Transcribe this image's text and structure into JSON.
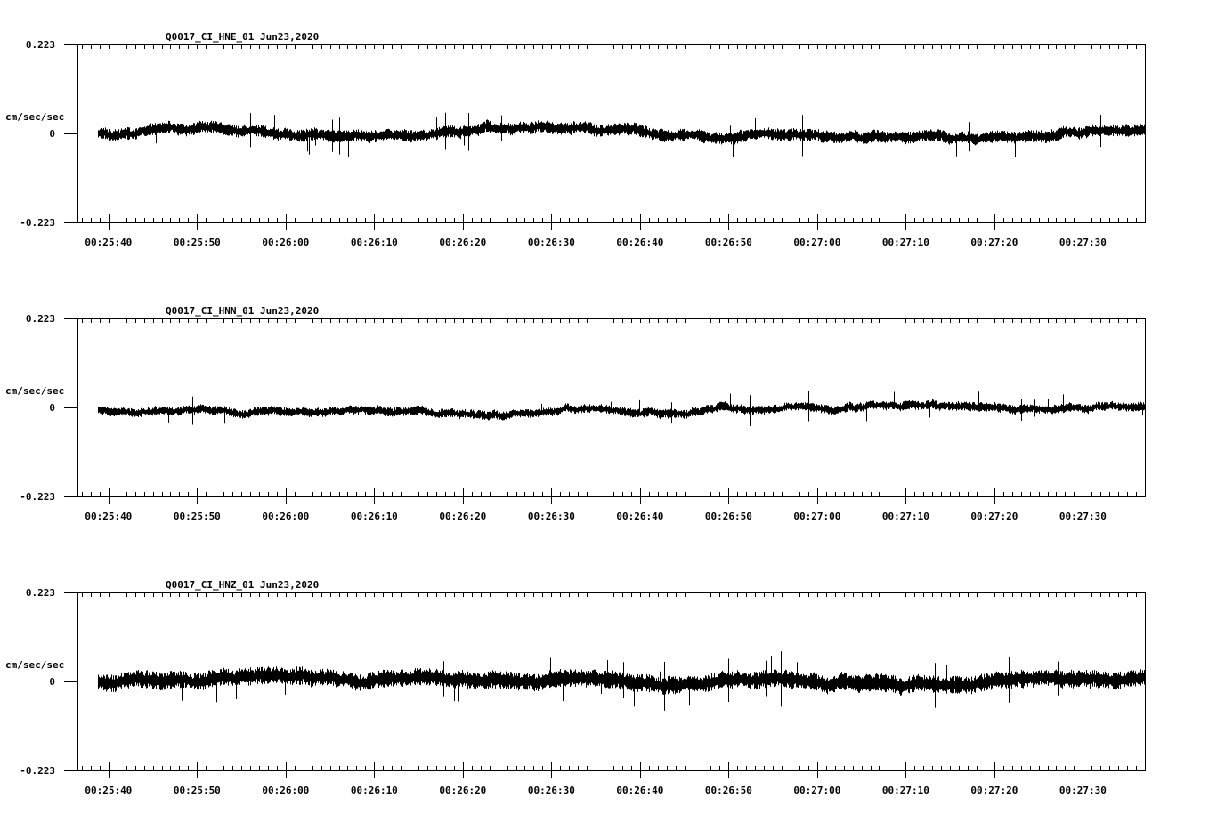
{
  "chart_data": [
    {
      "type": "line",
      "title": "Q0017_CI_HNE_01  Jun23,2020",
      "ylabel": "cm/sec/sec",
      "ylim": [
        -0.223,
        0.223
      ],
      "ytick_labels": [
        "0.223",
        "0",
        "-0.223"
      ],
      "xtick_labels": [
        "00:25:40",
        "00:25:50",
        "00:26:00",
        "00:26:10",
        "00:26:20",
        "00:26:30",
        "00:26:40",
        "00:26:50",
        "00:27:00",
        "00:27:10",
        "00:27:20",
        "00:27:30"
      ],
      "x_start": "00:25:36.5",
      "x_end": "00:27:37",
      "data_start": "00:25:38.8",
      "series": [
        {
          "amp": 0.011,
          "peak": 0.04,
          "drift": 0.0,
          "seed": 11
        }
      ]
    },
    {
      "type": "line",
      "title": "Q0017_CI_HNN_01  Jun23,2020",
      "ylabel": "cm/sec/sec",
      "ylim": [
        -0.223,
        0.223
      ],
      "ytick_labels": [
        "0.223",
        "0",
        "-0.223"
      ],
      "xtick_labels": [
        "00:25:40",
        "00:25:50",
        "00:26:00",
        "00:26:10",
        "00:26:20",
        "00:26:30",
        "00:26:40",
        "00:26:50",
        "00:27:00",
        "00:27:10",
        "00:27:20",
        "00:27:30"
      ],
      "x_start": "00:25:36.5",
      "x_end": "00:27:37",
      "data_start": "00:25:38.8",
      "series": [
        {
          "amp": 0.008,
          "peak": 0.03,
          "drift": 0.012,
          "seed": 23
        }
      ]
    },
    {
      "type": "line",
      "title": "Q0017_CI_HNZ_01  Jun23,2020",
      "ylabel": "cm/sec/sec",
      "ylim": [
        -0.223,
        0.223
      ],
      "ytick_labels": [
        "0.223",
        "0",
        "-0.223"
      ],
      "xtick_labels": [
        "00:25:40",
        "00:25:50",
        "00:26:00",
        "00:26:10",
        "00:26:20",
        "00:26:30",
        "00:26:40",
        "00:26:50",
        "00:27:00",
        "00:27:10",
        "00:27:20",
        "00:27:30"
      ],
      "x_start": "00:25:36.5",
      "x_end": "00:27:37",
      "data_start": "00:25:38.8",
      "series": [
        {
          "amp": 0.016,
          "peak": 0.05,
          "drift": 0.0,
          "seed": 37
        }
      ]
    }
  ]
}
